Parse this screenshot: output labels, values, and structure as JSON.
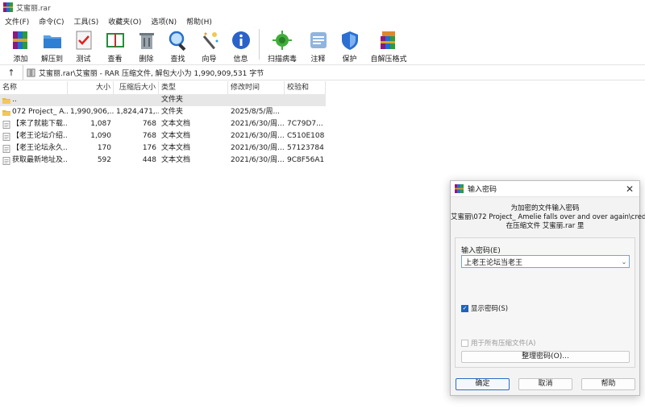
{
  "window": {
    "title": "艾蜜丽.rar"
  },
  "menu": [
    "文件(F)",
    "命令(C)",
    "工具(S)",
    "收藏夹(O)",
    "选项(N)",
    "帮助(H)"
  ],
  "toolbar": [
    {
      "label": "添加",
      "icon": "add-icon"
    },
    {
      "label": "解压到",
      "icon": "extract-icon"
    },
    {
      "label": "测试",
      "icon": "test-icon"
    },
    {
      "label": "查看",
      "icon": "view-icon"
    },
    {
      "label": "删除",
      "icon": "delete-icon"
    },
    {
      "label": "查找",
      "icon": "find-icon"
    },
    {
      "label": "向导",
      "icon": "wizard-icon"
    },
    {
      "label": "信息",
      "icon": "info-icon"
    },
    {
      "label": "扫描病毒",
      "icon": "virus-scan-icon"
    },
    {
      "label": "注释",
      "icon": "comment-icon"
    },
    {
      "label": "保护",
      "icon": "protect-icon"
    },
    {
      "label": "自解压格式",
      "icon": "sfx-icon"
    }
  ],
  "address": {
    "path": "艾蜜丽.rar\\艾蜜丽 - RAR 压缩文件, 解包大小为 1,990,909,531 字节"
  },
  "columns": {
    "name": "名称",
    "size": "大小",
    "packed": "压缩后大小",
    "type": "类型",
    "modified": "修改时间",
    "crc": "校验和"
  },
  "files": [
    {
      "name": "..",
      "size": "",
      "packed": "",
      "type": "文件夹",
      "modified": "",
      "crc": "",
      "kind": "folder"
    },
    {
      "name": "072 Project_ A...",
      "size": "1,990,906,...",
      "packed": "1,824,471,...",
      "type": "文件夹",
      "modified": "2025/8/5/周...",
      "crc": "",
      "kind": "folder"
    },
    {
      "name": "【来了就能下载...",
      "size": "1,087",
      "packed": "768",
      "type": "文本文档",
      "modified": "2021/6/30/周...",
      "crc": "7C79D7...",
      "kind": "file"
    },
    {
      "name": "【老王论坛介绍...",
      "size": "1,090",
      "packed": "768",
      "type": "文本文档",
      "modified": "2021/6/30/周...",
      "crc": "C510E108",
      "kind": "file"
    },
    {
      "name": "【老王论坛永久...",
      "size": "170",
      "packed": "176",
      "type": "文本文档",
      "modified": "2021/6/30/周...",
      "crc": "57123784",
      "kind": "file"
    },
    {
      "name": "获取最新地址及...",
      "size": "592",
      "packed": "448",
      "type": "文本文档",
      "modified": "2021/6/30/周...",
      "crc": "9C8F56A1",
      "kind": "file"
    }
  ],
  "dialog": {
    "title": "输入密码",
    "msg1": "为加密的文件输入密码",
    "msg2": "艾蜜丽\\072 Project_ Amelie falls over and over again\\credits.html",
    "msg3": "在压缩文件 艾蜜丽.rar 里",
    "pw_label": "输入密码(E)",
    "pw_value": "上老王论坛当老王",
    "show_pw": "显示密码(S)",
    "use_all": "用于所有压缩文件(A)",
    "organize": "整理密码(O)...",
    "ok": "确定",
    "cancel": "取消",
    "help": "帮助"
  }
}
